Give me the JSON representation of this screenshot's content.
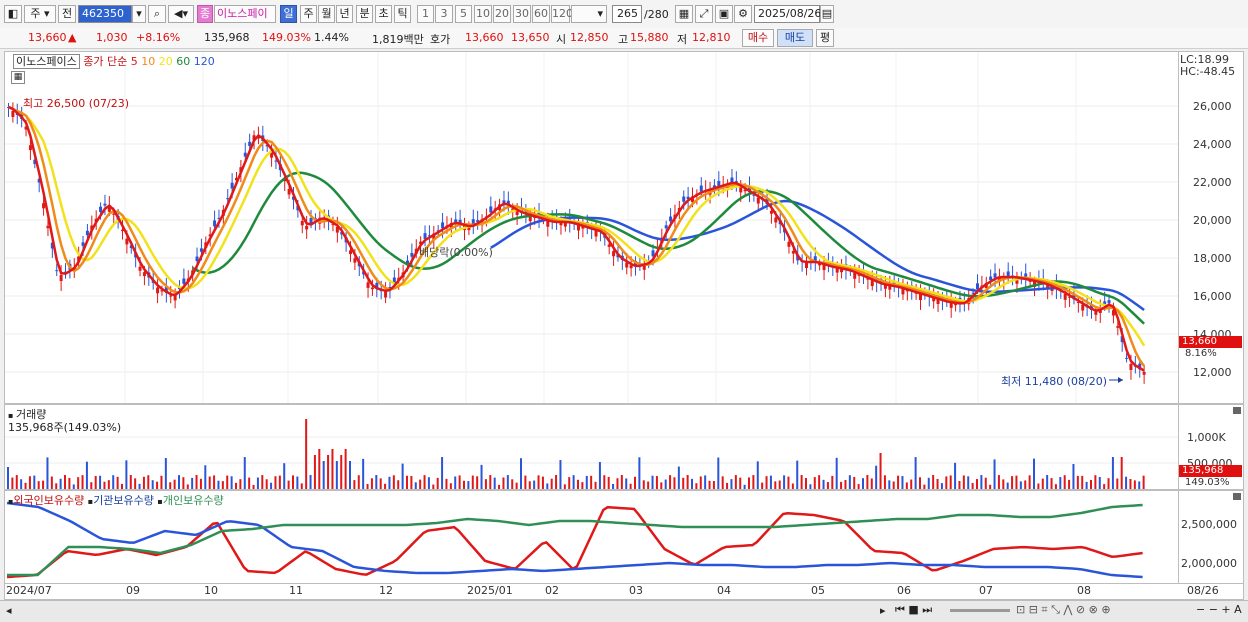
{
  "toolbar": {
    "period_type": "주",
    "prev_label": "전",
    "code": "462350",
    "stock_name": "이노스페이",
    "stock_badge": "종",
    "intervals": [
      "일",
      "주",
      "월",
      "년",
      "분",
      "초",
      "틱"
    ],
    "interval_selected": "일",
    "numbers": [
      "1",
      "3",
      "5",
      "10",
      "20",
      "30",
      "60",
      "120"
    ],
    "count": "265",
    "count_total": "/280",
    "date": "2025/08/26"
  },
  "quote": {
    "price": "13,660",
    "change": "1,030",
    "change_rate": "+8.16%",
    "volume": "135,968",
    "volume_ratio": "149.03%",
    "turnover": "1.44%",
    "amount": "1,819백만",
    "bid_label": "호가",
    "ask": "13,660",
    "bid": "13,650",
    "open_label": "시",
    "open": "12,850",
    "high_label": "고",
    "high": "15,880",
    "low_label": "저",
    "low": "12,810",
    "buy_button": "매수",
    "sell_button": "매도",
    "eval_button": "평"
  },
  "price_panel": {
    "legend_name": "이노스페이스",
    "legend_type": "종가 단순",
    "ma_periods": [
      "5",
      "10",
      "20",
      "60",
      "120"
    ],
    "ma_colors": [
      "#e01818",
      "#f08a18",
      "#f2e21c",
      "#1e8a3c",
      "#2a55d8"
    ],
    "high_note": "최고 26,500 (07/23)",
    "low_note": "최저 11,480 (08/20)",
    "dividend_note": "배당락(0.00%)",
    "lc": "LC:18.99",
    "hc": "HC:-48.45",
    "yticks": [
      "26,000",
      "24,000",
      "22,000",
      "20,000",
      "18,000",
      "16,000",
      "14,000",
      "12,000"
    ],
    "current_price_tag": "13,660",
    "current_rate_tag": "8.16%"
  },
  "volume_panel": {
    "title": "거래량",
    "subtitle": "135,968주(149.03%)",
    "yticks": [
      "1,000K",
      "500,000"
    ],
    "current_tag": "135,968",
    "current_rate": "149.03%"
  },
  "holdings_panel": {
    "legend": [
      "외국인보유수량",
      "기관보유수량",
      "개인보유수량"
    ],
    "colors": [
      "#e01818",
      "#2a55d8",
      "#2f8f55"
    ],
    "yticks": [
      "2,500,000",
      "2,000,000"
    ]
  },
  "x_axis": [
    "2024/07",
    "09",
    "10",
    "11",
    "12",
    "2025/01",
    "02",
    "03",
    "04",
    "05",
    "06",
    "07",
    "08",
    "08/26"
  ]
}
